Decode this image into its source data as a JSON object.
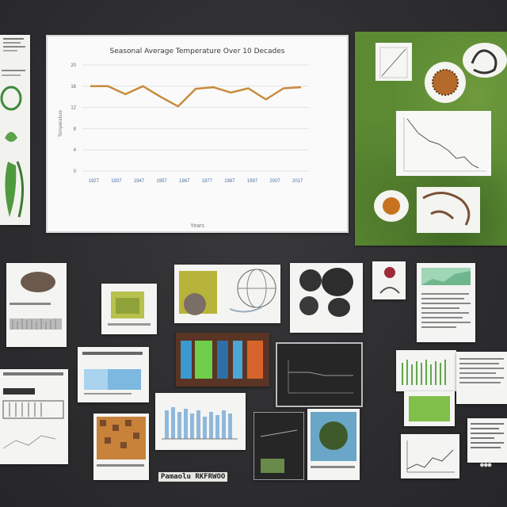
{
  "main_chart": {
    "title": "Seasonal Average Temperature Over 10 Decades",
    "xlabel": "Years",
    "ylabel": "Temperature",
    "yticks": [
      "20",
      "16",
      "12",
      "8",
      "4",
      "0"
    ],
    "xticks": [
      "1927",
      "1937",
      "1947",
      "1957",
      "1967",
      "1977",
      "1987",
      "1997",
      "2007",
      "2017"
    ],
    "series": [
      {
        "values": [
          16.0,
          16.0,
          14.5,
          16.0,
          14.0,
          12.2,
          15.5,
          15.8,
          14.8,
          15.6,
          13.5,
          15.6,
          15.8
        ],
        "color": "#c98a3c"
      }
    ]
  },
  "bottom_label": "Pamaolu RKFRWOO",
  "lower_label_right": "●●●",
  "colors": {
    "background": "#2f2f31",
    "line": "#c98a3c",
    "green_panel": "#5b8a33",
    "accent_green": "#7fbf4a",
    "accent_blue": "#6aa6d8"
  }
}
